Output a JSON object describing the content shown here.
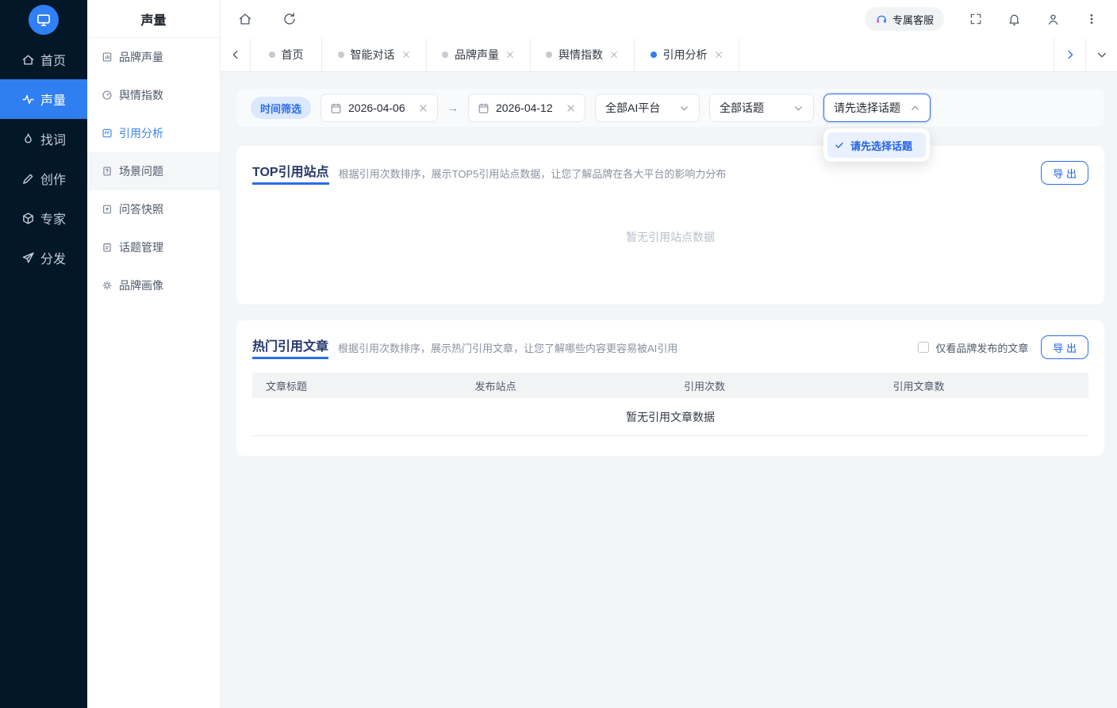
{
  "colors": {
    "accent": "#2f7ff0",
    "rail_bg": "#021727",
    "focus_border": "#2b6ce8",
    "badge_bg": "#dbe8fd",
    "title_underline": "#2b6cf0"
  },
  "rail": {
    "items": [
      {
        "label": "首页"
      },
      {
        "label": "声量"
      },
      {
        "label": "找词"
      },
      {
        "label": "创作"
      },
      {
        "label": "专家"
      },
      {
        "label": "分发"
      }
    ],
    "active_index": 1
  },
  "sidebar": {
    "title": "声量",
    "items": [
      {
        "label": "品牌声量"
      },
      {
        "label": "舆情指数"
      },
      {
        "label": "引用分析"
      },
      {
        "label": "场景问题"
      },
      {
        "label": "问答快照"
      },
      {
        "label": "话题管理"
      },
      {
        "label": "品牌画像"
      }
    ],
    "active_index": 2
  },
  "header": {
    "support_label": "专属客服"
  },
  "tabs": [
    {
      "label": "首页"
    },
    {
      "label": "智能对话"
    },
    {
      "label": "品牌声量"
    },
    {
      "label": "舆情指数"
    },
    {
      "label": "引用分析"
    }
  ],
  "filters": {
    "time_label": "时间筛选",
    "start_date": "2026-04-06",
    "range_separator": "→",
    "end_date": "2026-04-12",
    "platform_value": "全部AI平台",
    "topic_value": "全部话题",
    "topic_select_value": "请先选择话题",
    "dropdown": {
      "selected_option": "请先选择话题"
    }
  },
  "top_sites_card": {
    "title": "TOP引用站点",
    "description": "根据引用次数排序，展示TOP5引用站点数据，让您了解品牌在各大平台的影响力分布",
    "export_label": "导 出",
    "empty_text": "暂无引用站点数据"
  },
  "hot_articles_card": {
    "title": "热门引用文章",
    "description": "根据引用次数排序，展示热门引用文章，让您了解哪些内容更容易被AI引用",
    "filter_checkbox_label": "仅看品牌发布的文章",
    "export_label": "导 出",
    "empty_text": "暂无引用文章数据",
    "columns": [
      "文章标题",
      "发布站点",
      "引用次数",
      "引用文章数"
    ]
  }
}
